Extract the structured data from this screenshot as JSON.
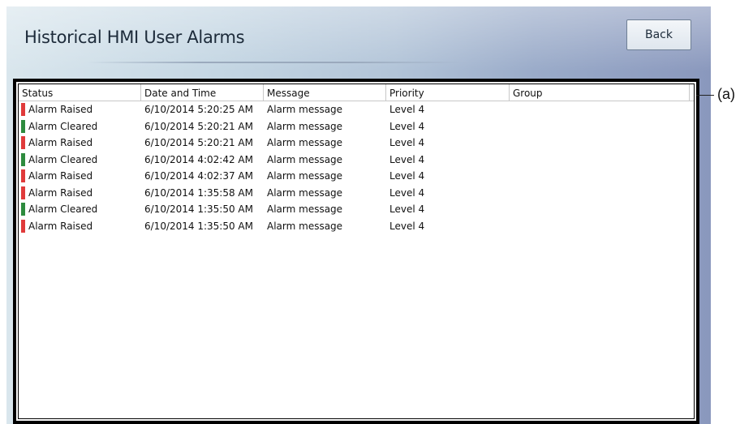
{
  "window": {
    "title": "Historical HMI User Alarms"
  },
  "toolbar": {
    "back_label": "Back"
  },
  "grid": {
    "columns": [
      "Status",
      "Date and Time",
      "Message",
      "Priority",
      "Group"
    ],
    "rows": [
      {
        "status": "Alarm Raised",
        "status_color": "#e03a3a",
        "datetime": "6/10/2014 5:20:25 AM",
        "message": "Alarm message",
        "priority": "Level 4",
        "group": ""
      },
      {
        "status": "Alarm Cleared",
        "status_color": "#2e8b3e",
        "datetime": "6/10/2014 5:20:21 AM",
        "message": "Alarm message",
        "priority": "Level 4",
        "group": ""
      },
      {
        "status": "Alarm Raised",
        "status_color": "#e03a3a",
        "datetime": "6/10/2014 5:20:21 AM",
        "message": "Alarm message",
        "priority": "Level 4",
        "group": ""
      },
      {
        "status": "Alarm Cleared",
        "status_color": "#2e8b3e",
        "datetime": "6/10/2014 4:02:42 AM",
        "message": "Alarm message",
        "priority": "Level 4",
        "group": ""
      },
      {
        "status": "Alarm Raised",
        "status_color": "#e03a3a",
        "datetime": "6/10/2014 4:02:37 AM",
        "message": "Alarm message",
        "priority": "Level 4",
        "group": ""
      },
      {
        "status": "Alarm Raised",
        "status_color": "#e03a3a",
        "datetime": "6/10/2014 1:35:58 AM",
        "message": "Alarm message",
        "priority": "Level 4",
        "group": ""
      },
      {
        "status": "Alarm Cleared",
        "status_color": "#2e8b3e",
        "datetime": "6/10/2014 1:35:50 AM",
        "message": "Alarm message",
        "priority": "Level 4",
        "group": ""
      },
      {
        "status": "Alarm Raised",
        "status_color": "#e03a3a",
        "datetime": "6/10/2014 1:35:50 AM",
        "message": "Alarm message",
        "priority": "Level 4",
        "group": ""
      }
    ]
  },
  "callout": {
    "label": "(a)"
  }
}
